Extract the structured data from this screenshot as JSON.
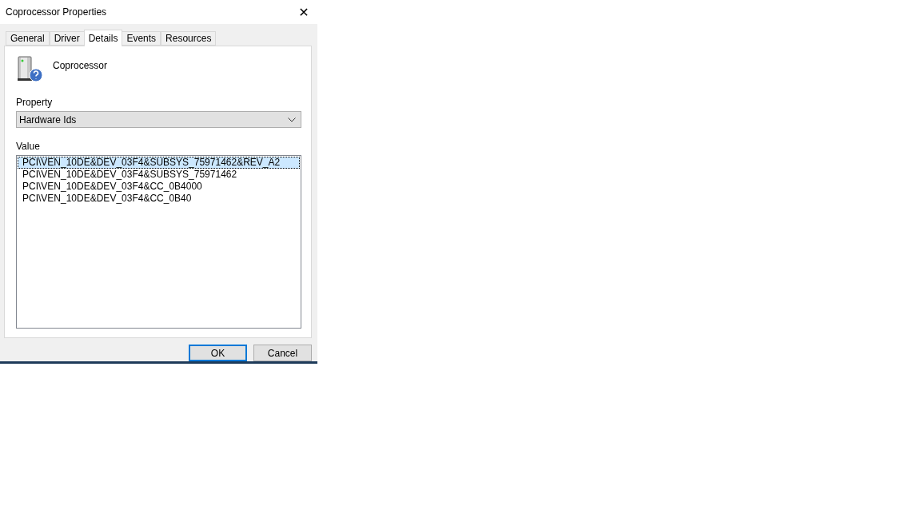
{
  "window": {
    "title": "Coprocessor Properties",
    "close": "✕"
  },
  "tabs": [
    {
      "label": "General",
      "selected": false
    },
    {
      "label": "Driver",
      "selected": false
    },
    {
      "label": "Details",
      "selected": true
    },
    {
      "label": "Events",
      "selected": false
    },
    {
      "label": "Resources",
      "selected": false
    }
  ],
  "device": {
    "name": "Coprocessor"
  },
  "property": {
    "label": "Property",
    "value": "Hardware Ids"
  },
  "value": {
    "label": "Value",
    "items": [
      {
        "text": "PCI\\VEN_10DE&DEV_03F4&SUBSYS_75971462&REV_A2",
        "selected": true
      },
      {
        "text": "PCI\\VEN_10DE&DEV_03F4&SUBSYS_75971462",
        "selected": false
      },
      {
        "text": "PCI\\VEN_10DE&DEV_03F4&CC_0B4000",
        "selected": false
      },
      {
        "text": "PCI\\VEN_10DE&DEV_03F4&CC_0B40",
        "selected": false
      }
    ]
  },
  "buttons": [
    {
      "label": "OK",
      "default": true
    },
    {
      "label": "Cancel",
      "default": false
    }
  ]
}
